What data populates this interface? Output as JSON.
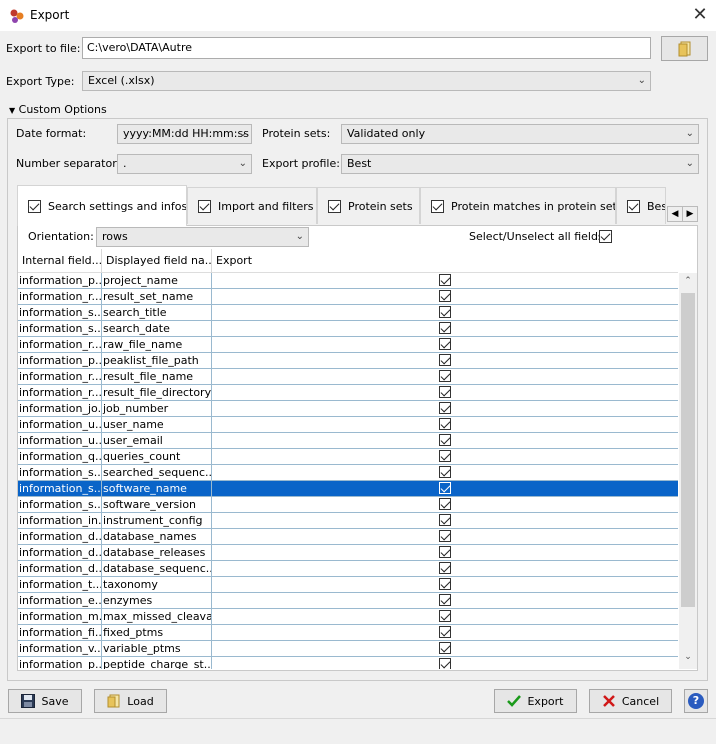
{
  "window": {
    "title": "Export",
    "close_glyph": "✕"
  },
  "export_file": {
    "label": "Export to file:",
    "value": "C:\\vero\\DATA\\Autre"
  },
  "export_type": {
    "label": "Export Type:",
    "value": "Excel (.xlsx)"
  },
  "custom_options": {
    "label": "Custom Options"
  },
  "date_format": {
    "label": "Date format:",
    "value": "yyyy:MM:dd HH:mm:ss"
  },
  "protein_sets": {
    "label": "Protein sets:",
    "value": "Validated only"
  },
  "number_separator": {
    "label": "Number separator:",
    "value": "."
  },
  "export_profile": {
    "label": "Export profile:",
    "value": "Best"
  },
  "tabs": [
    {
      "label": "Search settings and infos",
      "checked": true,
      "selected": true
    },
    {
      "label": "Import and filters",
      "checked": true
    },
    {
      "label": "Protein sets",
      "checked": true
    },
    {
      "label": "Protein matches in protein sets",
      "checked": true
    },
    {
      "label": "Bes",
      "checked": true
    }
  ],
  "orientation": {
    "label": "Orientation:",
    "value": "rows"
  },
  "select_all": {
    "label": "Select/Unselect all fields",
    "checked": true
  },
  "columns": [
    "Internal field...",
    "Displayed field na...",
    "Export"
  ],
  "rows": [
    {
      "internal": "information_p...",
      "displayed": "project_name"
    },
    {
      "internal": "information_r...",
      "displayed": "result_set_name"
    },
    {
      "internal": "information_s...",
      "displayed": "search_title"
    },
    {
      "internal": "information_s...",
      "displayed": "search_date"
    },
    {
      "internal": "information_r...",
      "displayed": "raw_file_name"
    },
    {
      "internal": "information_p...",
      "displayed": "peaklist_file_path"
    },
    {
      "internal": "information_r...",
      "displayed": "result_file_name"
    },
    {
      "internal": "information_r...",
      "displayed": "result_file_directory"
    },
    {
      "internal": "information_jo...",
      "displayed": "job_number"
    },
    {
      "internal": "information_u...",
      "displayed": "user_name"
    },
    {
      "internal": "information_u...",
      "displayed": "user_email"
    },
    {
      "internal": "information_q...",
      "displayed": "queries_count"
    },
    {
      "internal": "information_s...",
      "displayed": "searched_sequenc..."
    },
    {
      "internal": "information_s...",
      "displayed": "software_name",
      "selected": true
    },
    {
      "internal": "information_s...",
      "displayed": "software_version"
    },
    {
      "internal": "information_in...",
      "displayed": "instrument_config"
    },
    {
      "internal": "information_d...",
      "displayed": "database_names"
    },
    {
      "internal": "information_d...",
      "displayed": "database_releases"
    },
    {
      "internal": "information_d...",
      "displayed": "database_sequenc..."
    },
    {
      "internal": "information_t...",
      "displayed": "taxonomy"
    },
    {
      "internal": "information_e...",
      "displayed": "enzymes"
    },
    {
      "internal": "information_m...",
      "displayed": "max_missed_cleava..."
    },
    {
      "internal": "information_fi...",
      "displayed": "fixed_ptms"
    },
    {
      "internal": "information_v...",
      "displayed": "variable_ptms"
    },
    {
      "internal": "information_p...",
      "displayed": "peptide_charge_st..."
    }
  ],
  "buttons": {
    "save": "Save",
    "load": "Load",
    "export": "Export",
    "cancel": "Cancel",
    "help": "?"
  },
  "colors": {
    "selection": "#0a64c8",
    "export_check": "#1a9a1a",
    "cancel_x": "#d01818",
    "help": "#2a5bbf"
  },
  "icons": {
    "app": "app-logo-icon",
    "browse": "folder-icon",
    "save": "floppy-disk-icon",
    "load": "folder-icon",
    "export": "check-icon",
    "cancel": "x-icon",
    "help": "help-icon"
  }
}
